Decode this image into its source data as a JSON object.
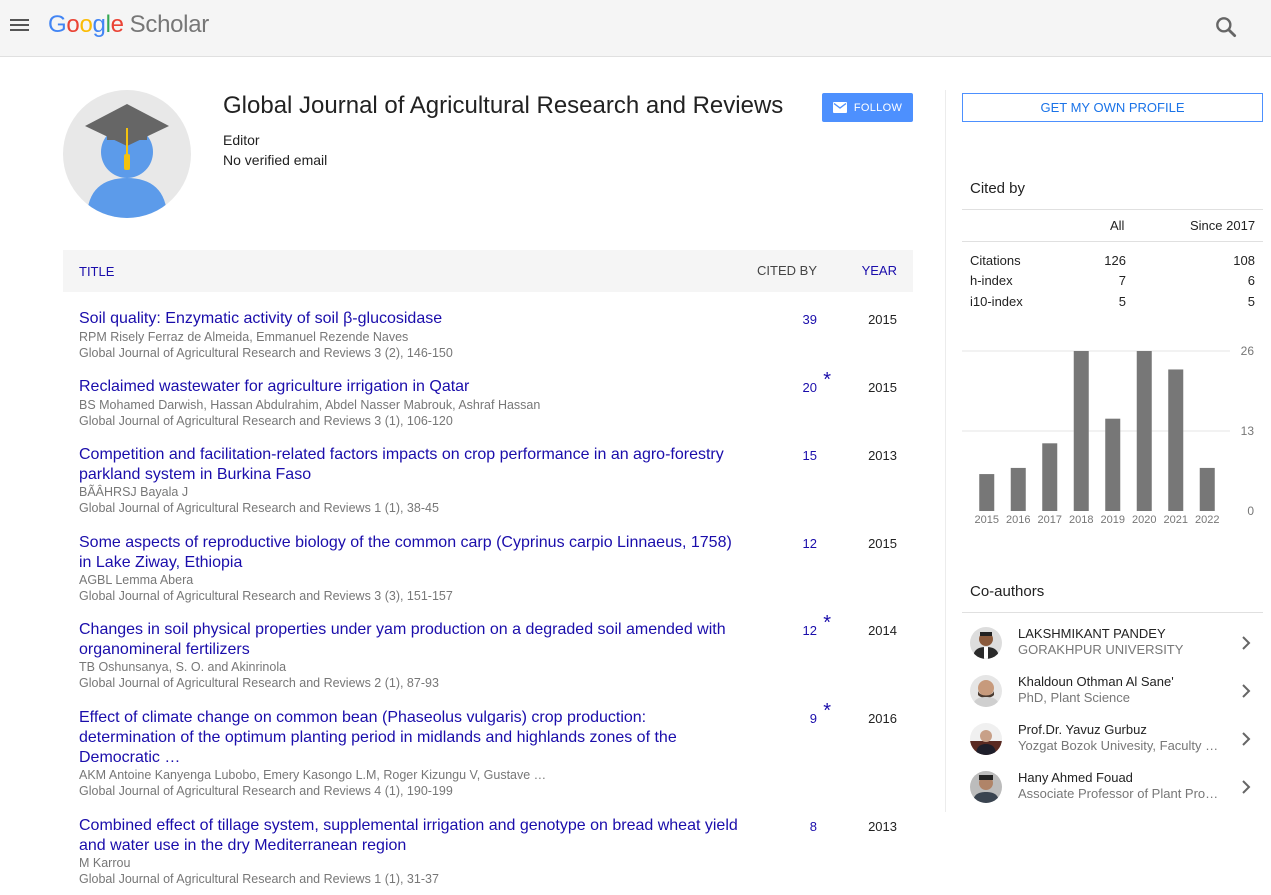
{
  "header": {
    "logo_letters": [
      "G",
      "o",
      "o",
      "g",
      "l",
      "e"
    ],
    "logo_product": "Scholar"
  },
  "profile": {
    "name": "Global Journal of Agricultural Research and Reviews",
    "affiliation": "Editor",
    "email": "No verified email",
    "follow_label": "FOLLOW"
  },
  "table": {
    "col_title": "TITLE",
    "col_cited": "CITED BY",
    "col_year": "YEAR",
    "rows": [
      {
        "title": "Soil quality: Enzymatic activity of soil β-glucosidase",
        "authors": "RPM Risely Ferraz de Almeida, Emmanuel Rezende Naves",
        "venue": "Global Journal of Agricultural Research and Reviews 3 (2), 146-150",
        "cited": "39",
        "star": "",
        "year": "2015"
      },
      {
        "title": "Reclaimed wastewater for agriculture irrigation in Qatar",
        "authors": "BS Mohamed Darwish, Hassan Abdulrahim, Abdel Nasser Mabrouk, Ashraf Hassan",
        "venue": "Global Journal of Agricultural Research and Reviews 3 (1), 106-120",
        "cited": "20",
        "star": "*",
        "year": "2015"
      },
      {
        "title": "Competition and facilitation-related factors impacts on crop performance in an agro-forestry parkland system in Burkina Faso",
        "authors": "BÃÂHRSJ Bayala J",
        "venue": "Global Journal of Agricultural Research and Reviews 1 (1), 38-45",
        "cited": "15",
        "star": "",
        "year": "2013"
      },
      {
        "title": "Some aspects of reproductive biology of the common carp (Cyprinus carpio Linnaeus, 1758) in Lake Ziway, Ethiopia",
        "authors": "AGBL Lemma Abera",
        "venue": "Global Journal of Agricultural Research and Reviews 3 (3), 151-157",
        "cited": "12",
        "star": "",
        "year": "2015"
      },
      {
        "title": "Changes in soil physical properties under yam production on a degraded soil amended with organomineral fertilizers",
        "authors": "TB Oshunsanya, S. O. and Akinrinola",
        "venue": "Global Journal of Agricultural Research and Reviews 2 (1), 87-93",
        "cited": "12",
        "star": "*",
        "year": "2014"
      },
      {
        "title": "Effect of climate change on common bean (Phaseolus vulgaris) crop production: determination of the optimum planting period in midlands and highlands zones of the Democratic …",
        "authors": "AKM Antoine Kanyenga Lubobo, Emery Kasongo L.M, Roger Kizungu V, Gustave …",
        "venue": "Global Journal of Agricultural Research and Reviews 4 (1), 190-199",
        "cited": "9",
        "star": "*",
        "year": "2016"
      },
      {
        "title": "Combined effect of tillage system, supplemental irrigation and genotype on bread wheat yield and water use in the dry Mediterranean region",
        "authors": "M Karrou",
        "venue": "Global Journal of Agricultural Research and Reviews 1 (1), 31-37",
        "cited": "8",
        "star": "",
        "year": "2013"
      }
    ]
  },
  "sidebar": {
    "own_profile_label": "GET MY OWN PROFILE",
    "cited_by_title": "Cited by",
    "col_all": "All",
    "col_since": "Since 2017",
    "stats": [
      {
        "label": "Citations",
        "all": "126",
        "since": "108"
      },
      {
        "label": "h-index",
        "all": "7",
        "since": "6"
      },
      {
        "label": "i10-index",
        "all": "5",
        "since": "5"
      }
    ],
    "coauthors_title": "Co-authors",
    "coauthors": [
      {
        "name": "LAKSHMIKANT PANDEY",
        "affiliation": "GORAKHPUR UNIVERSITY"
      },
      {
        "name": "Khaldoun Othman Al Sane'",
        "affiliation": "PhD, Plant Science"
      },
      {
        "name": "Prof.Dr. Yavuz Gurbuz",
        "affiliation": "Yozgat Bozok Univesity, Faculty …"
      },
      {
        "name": "Hany Ahmed Fouad",
        "affiliation": "Associate Professor of Plant Pro…"
      }
    ]
  },
  "chart_data": {
    "type": "bar",
    "categories": [
      "2015",
      "2016",
      "2017",
      "2018",
      "2019",
      "2020",
      "2021",
      "2022"
    ],
    "values": [
      6,
      7,
      11,
      26,
      15,
      26,
      23,
      7
    ],
    "ylim": [
      0,
      26
    ],
    "yticks": [
      "26",
      "13",
      "0"
    ],
    "grid": true,
    "bar_color": "#777777"
  },
  "colors": {
    "link": "#1a0dab",
    "accent": "#4d90fe",
    "muted": "#777777"
  }
}
